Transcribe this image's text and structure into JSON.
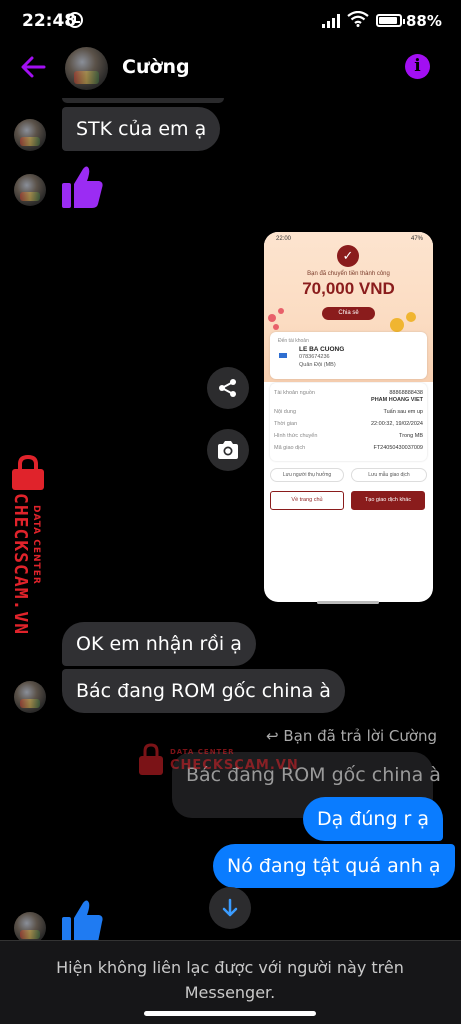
{
  "status": {
    "time": "22:48",
    "battery": "88%"
  },
  "header": {
    "name": "Cường"
  },
  "messages": {
    "m1": "STK của em ạ",
    "m2": "OK em nhận rồi ạ",
    "m3": "Bác đang ROM gốc china à",
    "reply_label": "Bạn đã trả lời Cường",
    "reply_quote": "Bác đang ROM gốc china à",
    "m4": "Dạ đúng r ạ",
    "m5": "Nó đang tật quá anh ạ"
  },
  "receipt": {
    "status_time": "22:00",
    "status_battery": "47%",
    "success": "Bạn đã chuyển tiền thành công",
    "amount": "70,000 VND",
    "share": "Chia sẻ",
    "to_label": "Đến tài khoản",
    "to_name": "LE BA CUONG",
    "to_phone": "0783674236",
    "to_bank": "Quân Đội (MB)",
    "rows": [
      {
        "k": "Tài khoản nguồn",
        "v": "88868888438"
      },
      {
        "k": "",
        "v": "PHAM HOANG VIET"
      },
      {
        "k": "Nội dung",
        "v": "Tuấn sau em up"
      },
      {
        "k": "Thời gian",
        "v": "22:00:32, 19/02/2024"
      },
      {
        "k": "Hình thức chuyển",
        "v": "Trong MB"
      },
      {
        "k": "Mã giao dịch",
        "v": "FT24050430037009"
      }
    ],
    "link1": "Lưu người thụ hưởng",
    "link2": "Lưu mẫu giao dịch",
    "btn_home": "Về trang chủ",
    "btn_new": "Tạo giao dịch khác"
  },
  "watermark": {
    "data_center": "DATA CENTER",
    "checkscam": "CHECKSCAM.VN"
  },
  "footer": {
    "text": "Hiện không liên lạc được với người này trên Messenger."
  },
  "colors": {
    "accent": "#a20ff2",
    "outgoing": "#0a7cff",
    "incoming": "#303033",
    "watermark": "#e0232b"
  }
}
